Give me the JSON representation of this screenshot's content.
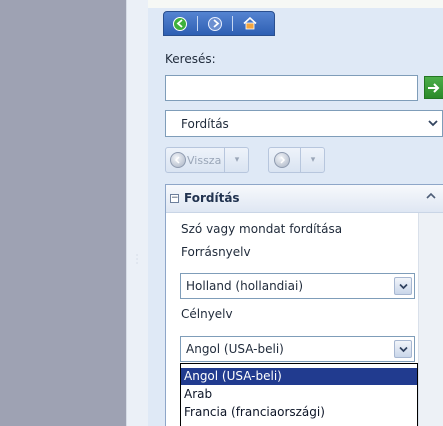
{
  "search": {
    "label": "Keresés:",
    "value": "",
    "go_icon": "go-arrow-icon"
  },
  "service": {
    "selected": "Fordítás",
    "icon": "chevron-down-icon"
  },
  "toolbar": {
    "back_label": "Vissza",
    "back_icon": "back-circle-icon",
    "forward_icon": "forward-circle-icon"
  },
  "nav": {
    "icons": [
      "back-green-icon",
      "forward-icon",
      "home-icon"
    ]
  },
  "panel": {
    "title": "Fordítás",
    "description": "Szó vagy mondat fordítása",
    "source_label": "Forrásnyelv",
    "source_value": "Holland (hollandiai)",
    "target_label": "Célnyelv",
    "target_value": "Angol (USA-beli)",
    "target_options": [
      "Angol (USA-beli)",
      "Arab",
      "Francia (franciaországi)"
    ]
  },
  "colors": {
    "highlight": "#213b8f",
    "nav_blue": "#2e5fb3",
    "go_green": "#2a8a2a"
  }
}
